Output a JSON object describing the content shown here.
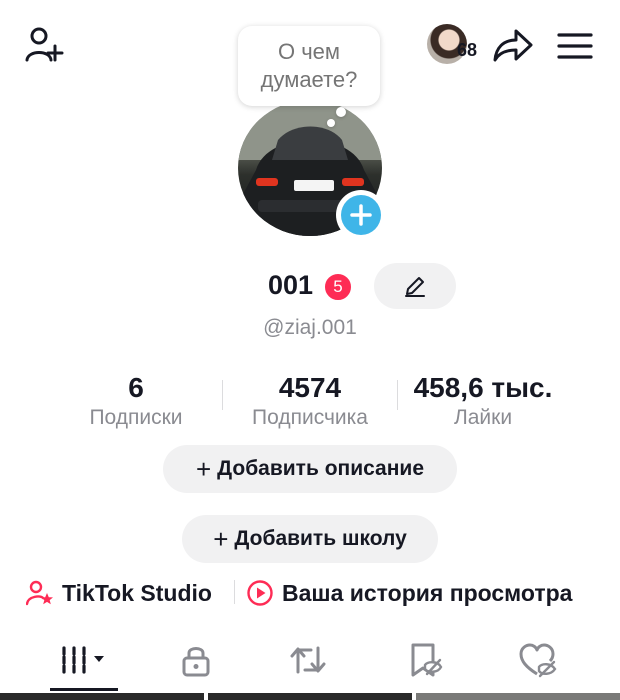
{
  "header": {
    "add_user_icon": "person-add-icon",
    "friends_count": "68",
    "share_icon": "share-arrow-icon",
    "menu_icon": "hamburger-menu-icon"
  },
  "thought_bubble": {
    "line1": "О чем",
    "line2": "думаете?"
  },
  "profile": {
    "name": "001",
    "notification_badge": "5",
    "handle": "@ziaj.001",
    "accent_color": "#3fb5e8",
    "badge_color": "#fe2c55"
  },
  "stats": [
    {
      "value": "6",
      "label": "Подписки"
    },
    {
      "value": "4574",
      "label": "Подписчика"
    },
    {
      "value": "458,6 тыс.",
      "label": "Лайки"
    }
  ],
  "buttons": {
    "add_description": "Добавить описание",
    "add_school": "Добавить школу",
    "plus_symbol": "+"
  },
  "links": {
    "studio": "TikTok Studio",
    "history": "Ваша история просмотра"
  },
  "tabs": [
    {
      "icon": "videos-grid-icon"
    },
    {
      "icon": "lock-icon"
    },
    {
      "icon": "repost-icon"
    },
    {
      "icon": "favorites-icon"
    },
    {
      "icon": "liked-icon"
    }
  ]
}
